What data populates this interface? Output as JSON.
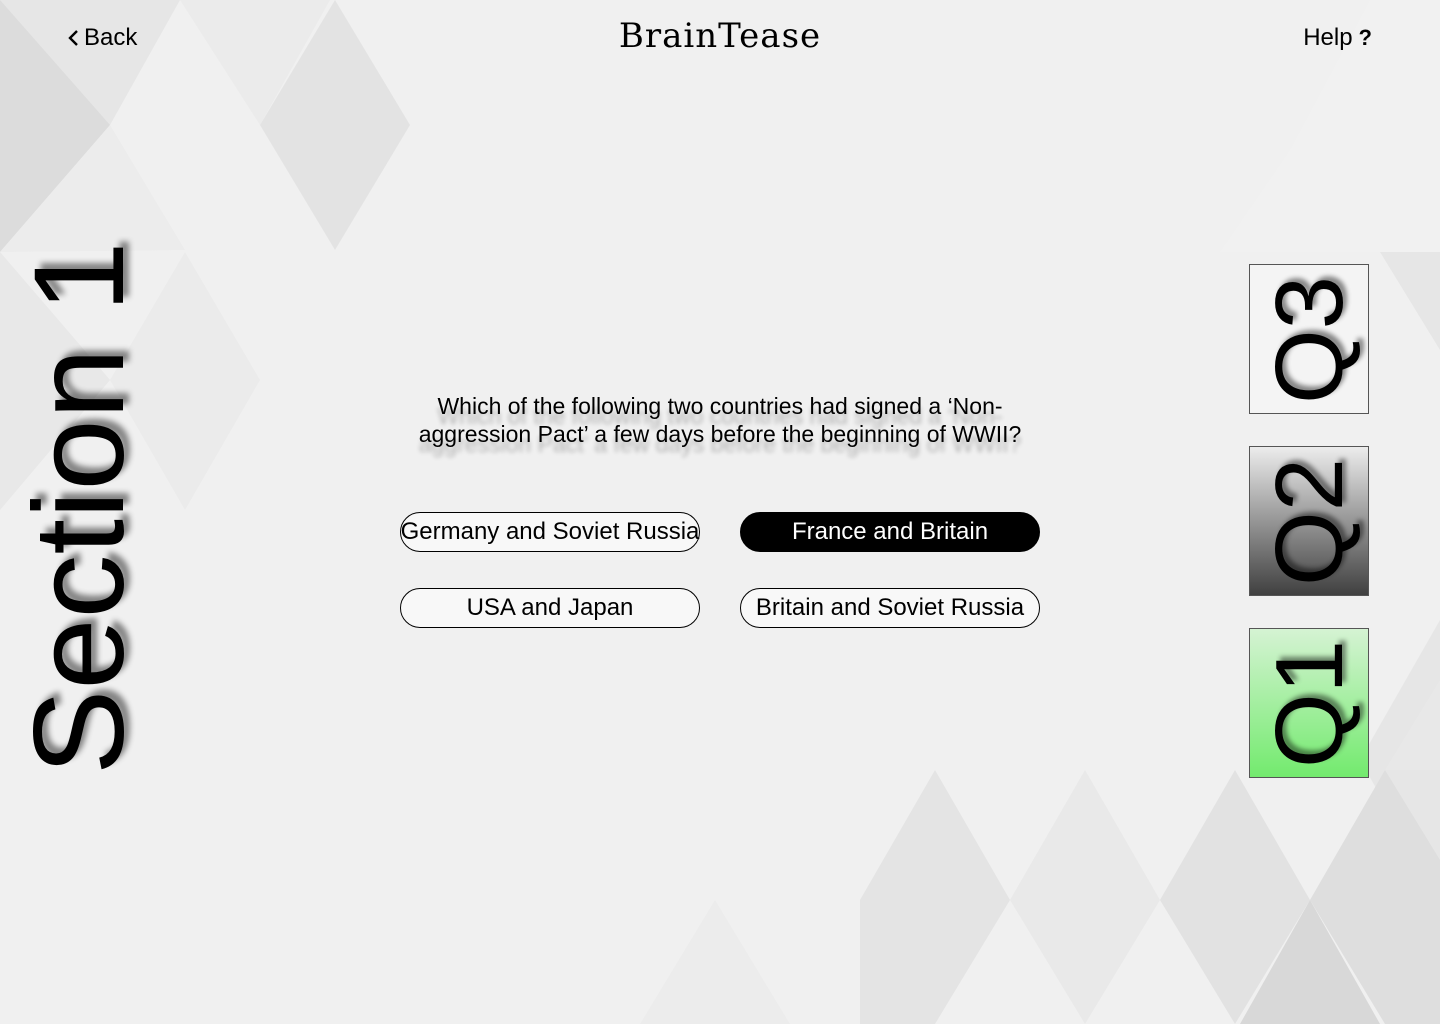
{
  "header": {
    "back_label": "Back",
    "app_title": "BrainTease",
    "help_label": "Help",
    "help_symbol": "?"
  },
  "section": {
    "label": "Section 1"
  },
  "question": {
    "text": "Which of the following two countries had signed a ‘Non-aggression Pact’ a few days before the beginning of WWII?"
  },
  "answers": [
    {
      "label": "Germany and Soviet Russia",
      "selected": false
    },
    {
      "label": "France and Britain",
      "selected": true
    },
    {
      "label": "USA and Japan",
      "selected": false
    },
    {
      "label": "Britain and Soviet Russia",
      "selected": false
    }
  ],
  "question_nav": [
    {
      "label": "Q3",
      "state": "upcoming"
    },
    {
      "label": "Q2",
      "state": "current"
    },
    {
      "label": "Q1",
      "state": "completed"
    }
  ],
  "icons": {
    "back": "chevron-left-icon",
    "help": "question-mark-icon"
  },
  "colors": {
    "selected_answer": "#000000",
    "completed_question": "#73ea6e",
    "background": "#f0f0f0"
  }
}
